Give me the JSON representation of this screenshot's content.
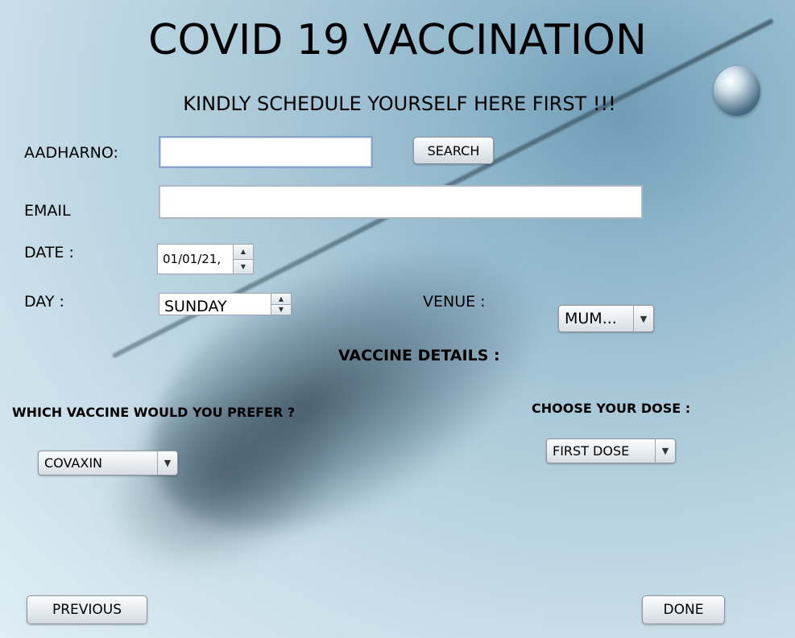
{
  "header": {
    "title": "COVID 19 VACCINATION",
    "subtitle": "KINDLY SCHEDULE YOURSELF HERE FIRST !!!"
  },
  "form": {
    "aadhar_label": "AADHARNO:",
    "aadhar_value": "",
    "search_label": "SEARCH",
    "email_label": "EMAIL",
    "email_value": "",
    "date_label": "DATE :",
    "date_value": "01/01/21,",
    "day_label": "DAY :",
    "day_value": "SUNDAY",
    "venue_label": "VENUE :",
    "venue_value": "MUM..."
  },
  "vaccine": {
    "section_title": "VACCINE DETAILS :",
    "prefer_label": "WHICH VACCINE WOULD YOU PREFER ?",
    "prefer_value": "COVAXIN",
    "dose_label": "CHOOSE YOUR DOSE :",
    "dose_value": "FIRST DOSE"
  },
  "footer": {
    "previous_label": "PREVIOUS",
    "done_label": "DONE"
  },
  "icons": {
    "spinner_up": "▲",
    "spinner_down": "▼",
    "combo_arrow": "▼"
  }
}
